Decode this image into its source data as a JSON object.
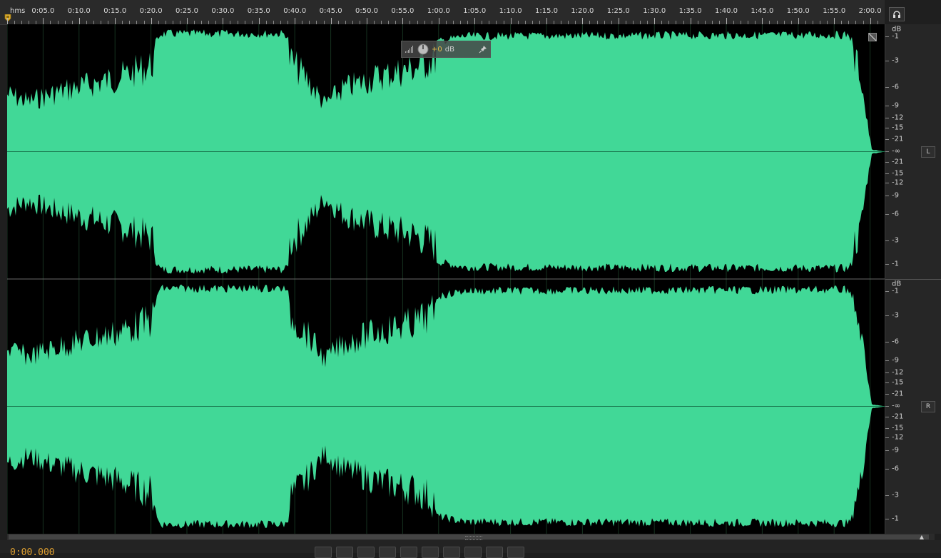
{
  "ruler": {
    "unit": "hms",
    "ticks": [
      "0:05.0",
      "0:10.0",
      "0:15.0",
      "0:20.0",
      "0:25.0",
      "0:30.0",
      "0:35.0",
      "0:40.0",
      "0:45.0",
      "0:50.0",
      "0:55.0",
      "1:00.0",
      "1:05.0",
      "1:10.0",
      "1:15.0",
      "1:20.0",
      "1:25.0",
      "1:30.0",
      "1:35.0",
      "1:40.0",
      "1:45.0",
      "1:50.0",
      "1:55.0",
      "2:00.0"
    ]
  },
  "hud": {
    "gain_value": "+0",
    "gain_unit": "dB"
  },
  "db_scale": {
    "unit": "dB",
    "left_labels": [
      "-1",
      "-3",
      "-6",
      "-9",
      "-12",
      "-15",
      "-21",
      "-∞",
      "-21",
      "-15",
      "-12",
      "-9",
      "-6",
      "-3",
      "-1"
    ],
    "right_labels": [
      "-1",
      "-3",
      "-6",
      "-9",
      "-12",
      "-15",
      "-21",
      "-∞",
      "-21",
      "-15",
      "-12",
      "-9",
      "-6",
      "-3",
      "-1"
    ]
  },
  "channels": {
    "left": "L",
    "right": "R"
  },
  "transport": {
    "time": "0:00.000"
  },
  "colors": {
    "waveform": "#41d897",
    "background": "#000000",
    "time_display": "#e0a030",
    "gain_value": "#e5b94a"
  },
  "icons": [
    "headphones-icon",
    "playhead-marker-icon",
    "gain-knob-icon",
    "level-meter-icon",
    "pin-icon",
    "resize-icon"
  ]
}
